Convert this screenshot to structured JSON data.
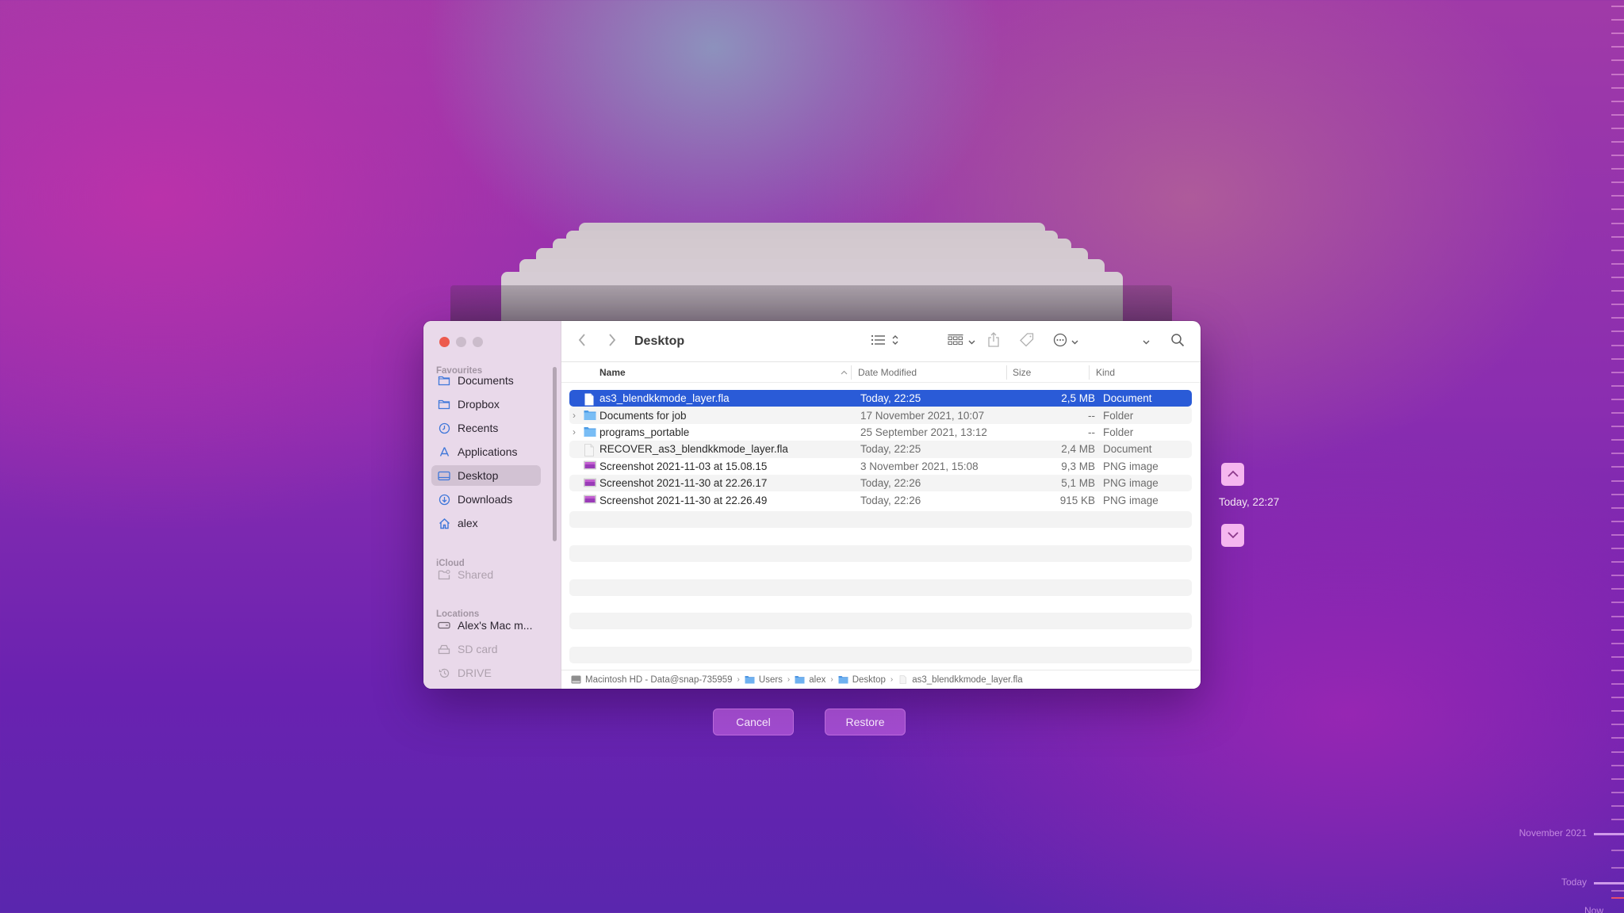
{
  "window": {
    "title": "Desktop",
    "traffic_lights": [
      "close",
      "minimize",
      "maximize"
    ]
  },
  "sidebar": {
    "sections": [
      {
        "label": "Favourites",
        "items": [
          {
            "label": "Documents",
            "icon": "folder-icon",
            "active": false,
            "enabled": true
          },
          {
            "label": "Dropbox",
            "icon": "folder-icon",
            "active": false,
            "enabled": true
          },
          {
            "label": "Recents",
            "icon": "clock-icon",
            "active": false,
            "enabled": true
          },
          {
            "label": "Applications",
            "icon": "applications-icon",
            "active": false,
            "enabled": true
          },
          {
            "label": "Desktop",
            "icon": "desktop-icon",
            "active": true,
            "enabled": true
          },
          {
            "label": "Downloads",
            "icon": "download-icon",
            "active": false,
            "enabled": true
          },
          {
            "label": "alex",
            "icon": "home-icon",
            "active": false,
            "enabled": true
          }
        ]
      },
      {
        "label": "iCloud",
        "items": [
          {
            "label": "Shared",
            "icon": "shared-folder-icon",
            "enabled": false
          }
        ]
      },
      {
        "label": "Locations",
        "items": [
          {
            "label": "Alex's Mac m...",
            "icon": "drive-icon",
            "enabled": true
          },
          {
            "label": "SD card",
            "icon": "external-drive-icon",
            "enabled": false
          },
          {
            "label": "DRIVE",
            "icon": "time-machine-icon",
            "enabled": false
          }
        ]
      }
    ]
  },
  "toolbar": {
    "back_icon": "chevron-left-icon",
    "forward_icon": "chevron-right-icon",
    "list_view_icon": "list-view-icon",
    "group_icon": "grid-view-icon",
    "share_icon": "share-icon",
    "tag_icon": "tag-icon",
    "more_icon": "ellipsis-circle-icon",
    "search_icon": "search-icon"
  },
  "columns": {
    "name": "Name",
    "date": "Date Modified",
    "size": "Size",
    "kind": "Kind",
    "sort_column": "Name",
    "sort_direction": "ascending"
  },
  "files": [
    {
      "name": "as3_blendkkmode_layer.fla",
      "date": "Today, 22:25",
      "size": "2,5 MB",
      "kind": "Document",
      "type": "document",
      "selected": true,
      "expandable": false
    },
    {
      "name": "Documents for job",
      "date": "17 November 2021, 10:07",
      "size": "--",
      "kind": "Folder",
      "type": "folder",
      "selected": false,
      "expandable": true
    },
    {
      "name": "programs_portable",
      "date": "25 September 2021, 13:12",
      "size": "--",
      "kind": "Folder",
      "type": "folder",
      "selected": false,
      "expandable": true
    },
    {
      "name": "RECOVER_as3_blendkkmode_layer.fla",
      "date": "Today, 22:25",
      "size": "2,4 MB",
      "kind": "Document",
      "type": "document",
      "selected": false,
      "expandable": false
    },
    {
      "name": "Screenshot 2021-11-03 at 15.08.15",
      "date": "3 November 2021, 15:08",
      "size": "9,3 MB",
      "kind": "PNG image",
      "type": "image",
      "selected": false,
      "expandable": false
    },
    {
      "name": "Screenshot 2021-11-30 at 22.26.17",
      "date": "Today, 22:26",
      "size": "5,1 MB",
      "kind": "PNG image",
      "type": "image",
      "selected": false,
      "expandable": false
    },
    {
      "name": "Screenshot 2021-11-30 at 22.26.49",
      "date": "Today, 22:26",
      "size": "915 KB",
      "kind": "PNG image",
      "type": "image",
      "selected": false,
      "expandable": false
    }
  ],
  "pathbar": [
    {
      "label": "Macintosh HD - Data@snap-735959",
      "icon": "hard-drive-icon"
    },
    {
      "label": "Users",
      "icon": "folder-icon"
    },
    {
      "label": "alex",
      "icon": "folder-icon"
    },
    {
      "label": "Desktop",
      "icon": "folder-icon"
    },
    {
      "label": "as3_blendkkmode_layer.fla",
      "icon": "document-icon"
    }
  ],
  "actions": {
    "cancel": "Cancel",
    "restore": "Restore"
  },
  "time_machine": {
    "current_snapshot": "Today, 22:27",
    "up_icon": "chevron-up-icon",
    "down_icon": "chevron-down-icon",
    "timeline_labels": [
      "November 2021",
      "Today",
      "Now"
    ]
  },
  "colors": {
    "selection": "#2a5bd7",
    "accent_blue": "#3f77d9",
    "close_button": "#ec5a4e",
    "button_bg": "#c86ee6",
    "nav_arrow_bg": "#f5b6ef",
    "timeline_now_marker": "#e8506a"
  }
}
